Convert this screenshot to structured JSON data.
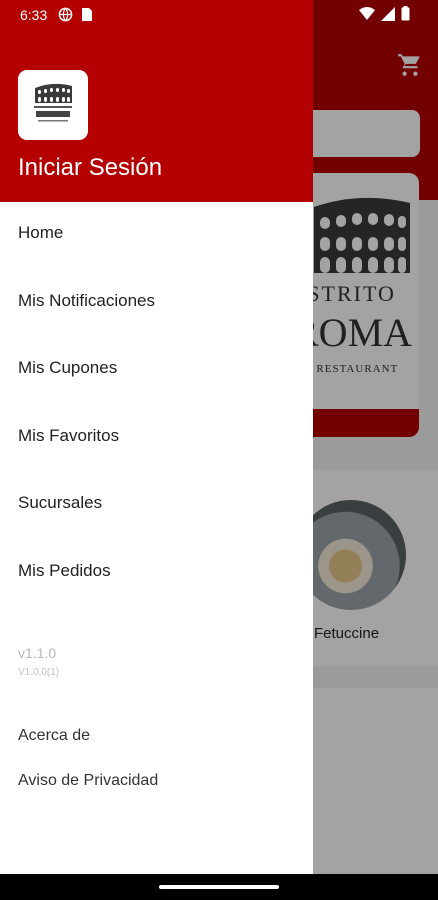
{
  "status_bar": {
    "time": "6:33"
  },
  "background": {
    "dish_label": "Fetuccine",
    "banner_line1": "ISTRITO",
    "banner_line2": "ROMA",
    "banner_line3": "CA RESTAURANT"
  },
  "drawer": {
    "login_label": "Iniciar Sesión",
    "menu_items": [
      {
        "label": "Home"
      },
      {
        "label": "Mis Notificaciones"
      },
      {
        "label": "Mis Cupones"
      },
      {
        "label": "Mis Favoritos"
      },
      {
        "label": "Sucursales"
      },
      {
        "label": "Mis Pedidos"
      }
    ],
    "version": "v1.1.0",
    "build": "V1.0.0(1)",
    "links": [
      {
        "label": "Acerca de"
      },
      {
        "label": "Aviso de Privacidad"
      }
    ]
  },
  "colors": {
    "brand_red": "#b40000",
    "scrim": "rgba(0,0,0,0.36)"
  },
  "icons": [
    "cart-icon",
    "wifi-icon",
    "signal-icon",
    "battery-icon",
    "globe-icon",
    "sim-icon",
    "colosseum-logo-icon"
  ]
}
